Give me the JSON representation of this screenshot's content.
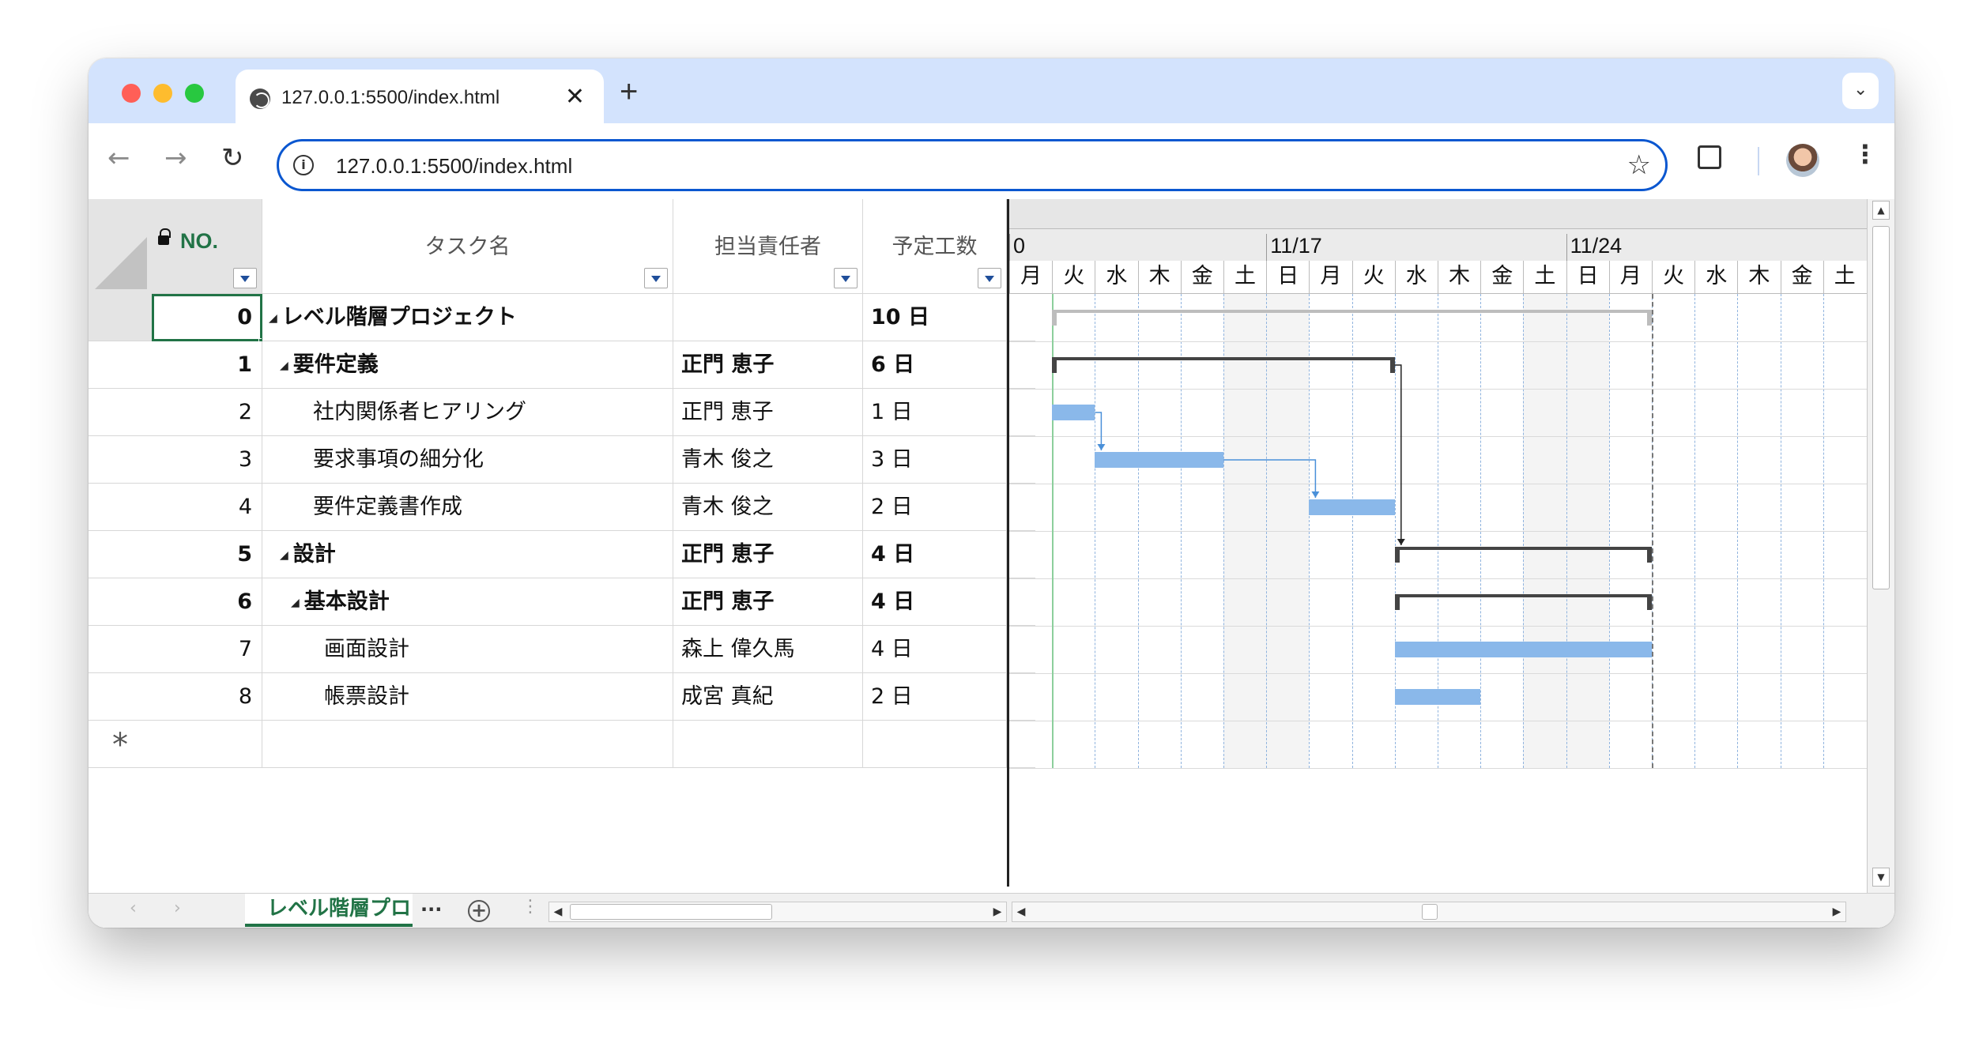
{
  "browser": {
    "tab_title": "127.0.0.1:5500/index.html",
    "url": "127.0.0.1:5500/index.html",
    "new_tab_symbol": "+",
    "close_symbol": "✕"
  },
  "grid": {
    "headers": {
      "no": "NO.",
      "task": "タスク名",
      "owner": "担当責任者",
      "effort": "予定工数"
    },
    "rows": [
      {
        "no": "0",
        "task": "レベル階層プロジェクト",
        "owner": "",
        "effort": "10 日",
        "bold": true,
        "indent": 0,
        "expand": true
      },
      {
        "no": "1",
        "task": "要件定義",
        "owner": "正門 恵子",
        "effort": "6 日",
        "bold": true,
        "indent": 1,
        "expand": true
      },
      {
        "no": "2",
        "task": "社内関係者ヒアリング",
        "owner": "正門 恵子",
        "effort": "1 日",
        "bold": false,
        "indent": 2,
        "expand": false
      },
      {
        "no": "3",
        "task": "要求事項の細分化",
        "owner": "青木 俊之",
        "effort": "3 日",
        "bold": false,
        "indent": 2,
        "expand": false
      },
      {
        "no": "4",
        "task": "要件定義書作成",
        "owner": "青木 俊之",
        "effort": "2 日",
        "bold": false,
        "indent": 2,
        "expand": false
      },
      {
        "no": "5",
        "task": "設計",
        "owner": "正門 恵子",
        "effort": "4 日",
        "bold": true,
        "indent": 1,
        "expand": true
      },
      {
        "no": "6",
        "task": "基本設計",
        "owner": "正門 恵子",
        "effort": "4 日",
        "bold": true,
        "indent": 2,
        "expand": true
      },
      {
        "no": "7",
        "task": "画面設計",
        "owner": "森上 偉久馬",
        "effort": "4 日",
        "bold": false,
        "indent": 3,
        "expand": false
      },
      {
        "no": "8",
        "task": "帳票設計",
        "owner": "成宮 真紀",
        "effort": "2 日",
        "bold": false,
        "indent": 3,
        "expand": false
      }
    ],
    "new_row_marker": "*"
  },
  "gantt": {
    "dates": [
      {
        "label": "0",
        "day_index": 0
      },
      {
        "label": "11/17",
        "day_index": 6
      },
      {
        "label": "11/24",
        "day_index": 13
      }
    ],
    "days": [
      "月",
      "火",
      "水",
      "木",
      "金",
      "土",
      "日",
      "月",
      "火",
      "水",
      "木",
      "金",
      "土",
      "日",
      "月",
      "火",
      "水",
      "木",
      "金",
      "土"
    ],
    "weekends": [
      5,
      12
    ],
    "today_day": 1,
    "bars": [
      {
        "row": 0,
        "type": "project",
        "start": 1,
        "end": 15
      },
      {
        "row": 1,
        "type": "summary",
        "start": 1,
        "end": 9
      },
      {
        "row": 2,
        "type": "task",
        "start": 1,
        "end": 2
      },
      {
        "row": 3,
        "type": "task",
        "start": 2,
        "end": 5
      },
      {
        "row": 4,
        "type": "task",
        "start": 7,
        "end": 9
      },
      {
        "row": 5,
        "type": "summary",
        "start": 9,
        "end": 15
      },
      {
        "row": 6,
        "type": "summary",
        "start": 9,
        "end": 15
      },
      {
        "row": 7,
        "type": "task",
        "start": 9,
        "end": 15
      },
      {
        "row": 8,
        "type": "task",
        "start": 9,
        "end": 11
      }
    ]
  },
  "sheet": {
    "tab_label": "レベル階層プロ",
    "more_label": "...",
    "add_symbol": "+"
  },
  "colors": {
    "accent": "#217346",
    "task_bar": "#8ab8ea",
    "summary_bar": "#444444",
    "link": "#0b57d0"
  }
}
